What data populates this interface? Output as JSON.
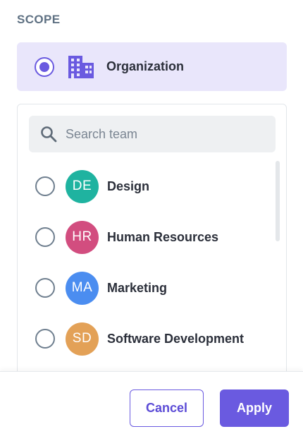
{
  "scope": {
    "label": "SCOPE"
  },
  "organization": {
    "label": "Organization",
    "selected": true,
    "icon": "building-icon"
  },
  "search": {
    "placeholder": "Search team",
    "value": ""
  },
  "teams": [
    {
      "initials": "DE",
      "name": "Design",
      "color": "#1fb3a0",
      "selected": false
    },
    {
      "initials": "HR",
      "name": "Human Resources",
      "color": "#d24d7f",
      "selected": false
    },
    {
      "initials": "MA",
      "name": "Marketing",
      "color": "#4b8df0",
      "selected": false
    },
    {
      "initials": "SD",
      "name": "Software Development",
      "color": "#e3a157",
      "selected": false
    }
  ],
  "footer": {
    "cancel_label": "Cancel",
    "apply_label": "Apply"
  },
  "colors": {
    "accent": "#6a5ae0",
    "selected_bg": "#e9e6fb"
  }
}
